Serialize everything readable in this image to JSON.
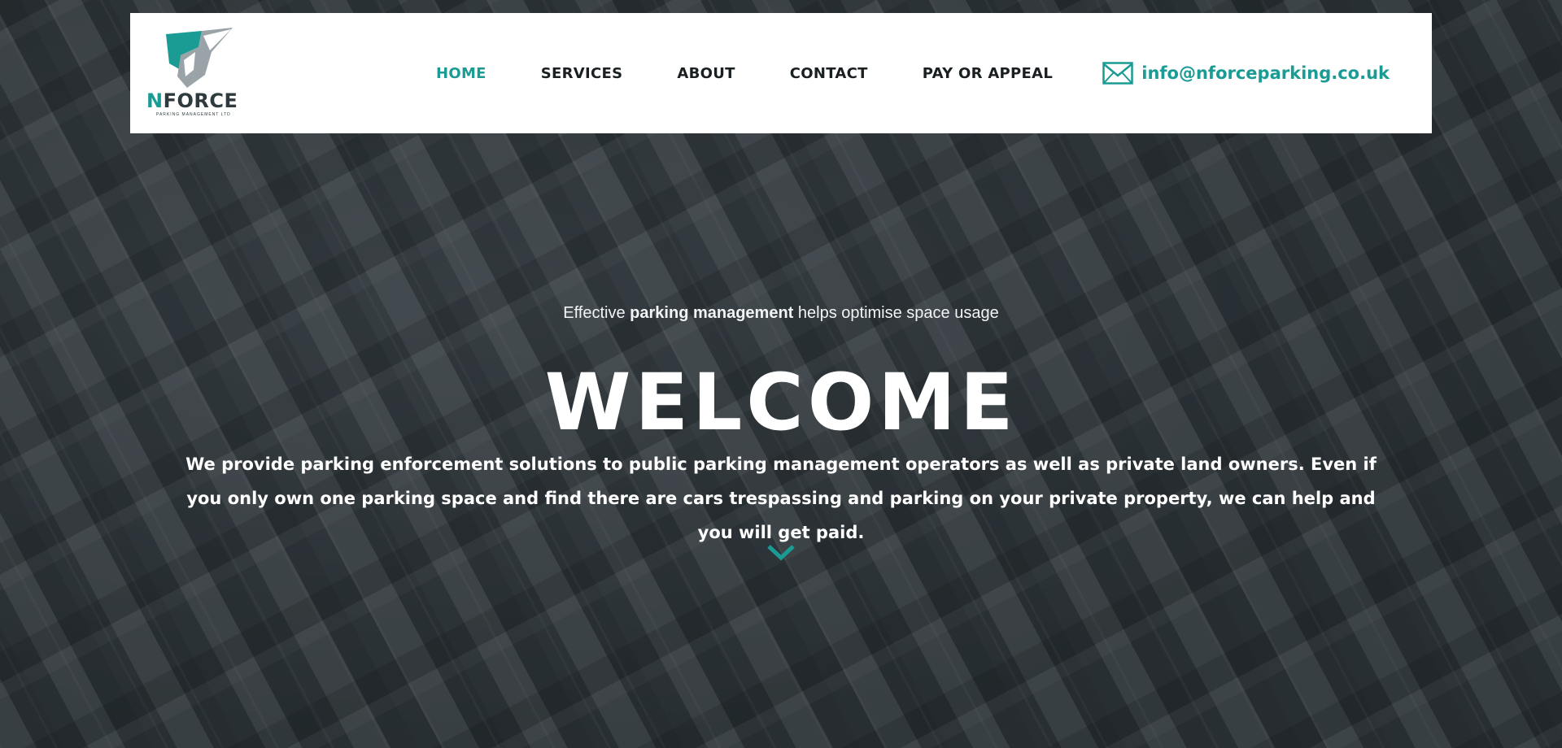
{
  "brand": {
    "name_initial": "N",
    "name_rest": "FORCE",
    "subtitle": "PARKING MANAGEMENT LTD",
    "accent_color": "#1a9b94",
    "dark_color": "#2f3a3f",
    "logo_icon": "shield-check-icon"
  },
  "nav": {
    "items": [
      {
        "label": "HOME",
        "active": true
      },
      {
        "label": "SERVICES",
        "active": false
      },
      {
        "label": "ABOUT",
        "active": false
      },
      {
        "label": "CONTACT",
        "active": false
      },
      {
        "label": "PAY OR APPEAL",
        "active": false
      }
    ]
  },
  "contact": {
    "email": "info@nforceparking.co.uk",
    "icon": "envelope-icon"
  },
  "hero": {
    "tagline_pre": "Effective",
    "tagline_bold": "parking management",
    "tagline_post": "helps optimise space usage",
    "title": "WELCOME",
    "intro": "We provide parking enforcement solutions to public parking management operators as well as private land owners. Even if you only own one parking space and find there are cars trespassing and parking on your private property, we can help and you will get paid.",
    "scroll_icon": "chevron-down-icon",
    "background": "aerial-car-park-photo"
  }
}
